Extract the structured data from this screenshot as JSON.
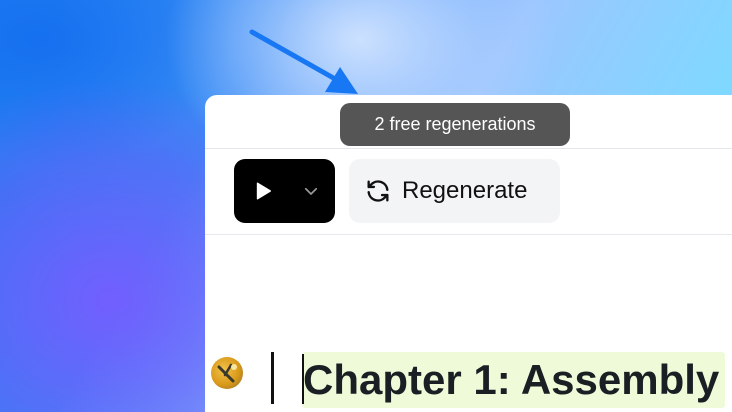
{
  "tooltip": {
    "text": "2 free regenerations"
  },
  "toolbar": {
    "play_icon": "play-icon",
    "dropdown_icon": "chevron-down-icon",
    "regenerate_icon": "refresh-icon",
    "regenerate_label": "Regenerate"
  },
  "editor": {
    "heading": "Chapter 1: Assembly",
    "highlight_color": "#eefad8"
  },
  "colors": {
    "play_button_bg": "#000000",
    "regenerate_bg": "#f3f4f6",
    "tooltip_bg": "#555555",
    "pointer_arrow": "#1877f2"
  }
}
